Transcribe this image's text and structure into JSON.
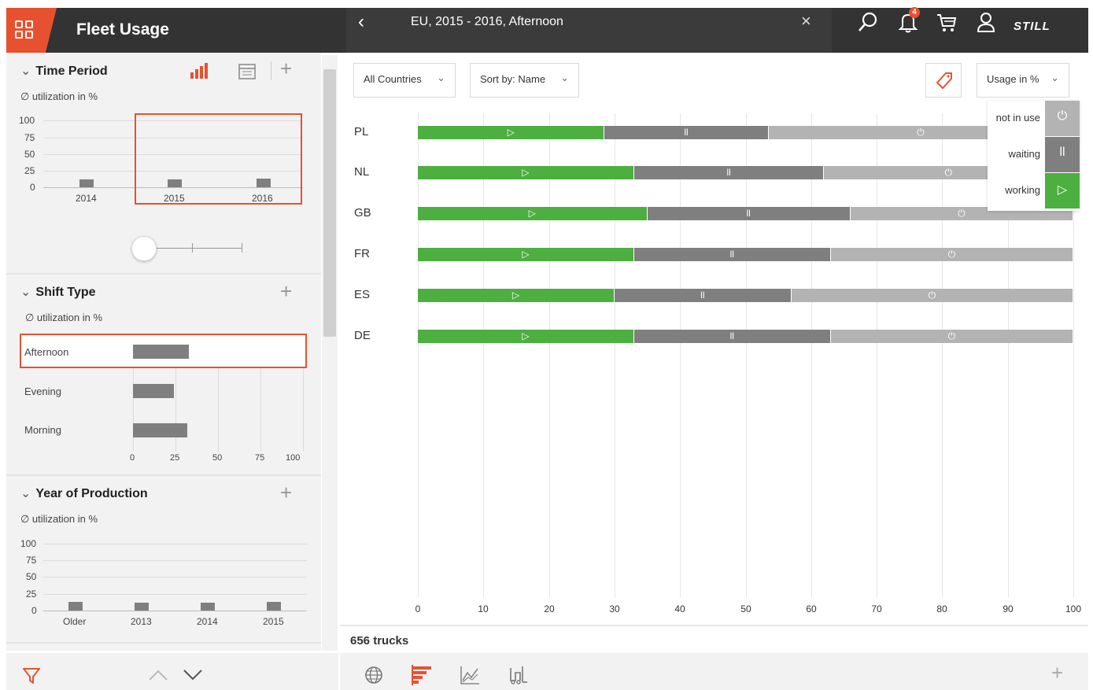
{
  "header": {
    "app_title": "Fleet Usage",
    "breadcrumb": "EU, 2015 - 2016, Afternoon",
    "back_glyph": "‹",
    "close_glyph": "×",
    "notification_count": "4",
    "brand": "STILL",
    "icons": [
      "apps-grid-icon",
      "search-icon",
      "bell-icon",
      "cart-icon",
      "user-icon"
    ]
  },
  "left_panel": {
    "time_period": {
      "title": "Time Period",
      "subtitle": "∅ utilization in %",
      "y_ticks": [
        "100",
        "75",
        "50",
        "25",
        "0"
      ],
      "categories": [
        "2014",
        "2015",
        "2016"
      ],
      "values": [
        12,
        12,
        13
      ],
      "selected": [
        "2015",
        "2016"
      ]
    },
    "shift_type": {
      "title": "Shift Type",
      "subtitle": "∅ utilization in %",
      "items": [
        {
          "label": "Afternoon",
          "value": 33,
          "selected": true
        },
        {
          "label": "Evening",
          "value": 24,
          "selected": false
        },
        {
          "label": "Morning",
          "value": 32,
          "selected": false
        }
      ],
      "x_ticks": [
        "0",
        "25",
        "50",
        "75",
        "100"
      ]
    },
    "year_of_production": {
      "title": "Year of Production",
      "subtitle": "∅ utilization in %",
      "y_ticks": [
        "100",
        "75",
        "50",
        "25",
        "0"
      ],
      "categories": [
        "Older",
        "2013",
        "2014",
        "2015"
      ],
      "values": [
        13,
        12,
        12,
        13
      ]
    }
  },
  "toolbar": {
    "countries": "All Countries",
    "sort": "Sort by: Name",
    "usage": "Usage in %"
  },
  "legend": {
    "not_in_use": "not in use",
    "waiting": "waiting",
    "working": "working"
  },
  "colors": {
    "accent": "#e8512f",
    "working": "#4caf3f",
    "waiting": "#7f7f7f",
    "not_in_use": "#b3b3b3",
    "header_bg": "#333333"
  },
  "chart_data": {
    "type": "bar",
    "stacked": true,
    "orientation": "horizontal",
    "categories": [
      "PL",
      "NL",
      "GB",
      "FR",
      "ES",
      "DE"
    ],
    "series": [
      {
        "name": "working",
        "values": [
          28.5,
          33,
          35,
          33,
          30,
          33
        ]
      },
      {
        "name": "waiting",
        "values": [
          25,
          29,
          31,
          30,
          27,
          30
        ]
      },
      {
        "name": "not in use",
        "values": [
          46.5,
          38,
          34,
          37,
          43,
          37
        ]
      }
    ],
    "xlim": [
      0,
      100
    ],
    "x_ticks": [
      "0",
      "10",
      "20",
      "30",
      "40",
      "50",
      "60",
      "70",
      "80",
      "90",
      "100"
    ],
    "grid": true,
    "legend_position": "top-right"
  },
  "footer": {
    "truck_count": "656 trucks"
  }
}
